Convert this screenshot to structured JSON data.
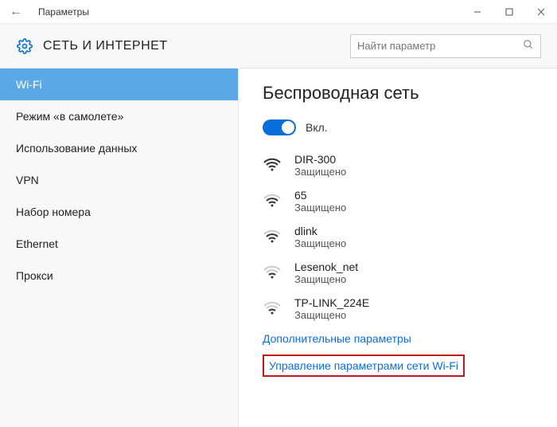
{
  "titlebar": {
    "back_icon": "←",
    "title": "Параметры"
  },
  "header": {
    "title": "СЕТЬ И ИНТЕРНЕТ",
    "search_placeholder": "Найти параметр"
  },
  "sidebar": {
    "items": [
      {
        "label": "Wi-Fi",
        "active": true
      },
      {
        "label": "Режим «в самолете»",
        "active": false
      },
      {
        "label": "Использование данных",
        "active": false
      },
      {
        "label": "VPN",
        "active": false
      },
      {
        "label": "Набор номера",
        "active": false
      },
      {
        "label": "Ethernet",
        "active": false
      },
      {
        "label": "Прокси",
        "active": false
      }
    ]
  },
  "main": {
    "heading": "Беспроводная сеть",
    "toggle_label": "Вкл.",
    "toggle_on": true,
    "networks": [
      {
        "name": "DIR-300",
        "status": "Защищено",
        "strength": 4
      },
      {
        "name": "65",
        "status": "Защищено",
        "strength": 3
      },
      {
        "name": "dlink",
        "status": "Защищено",
        "strength": 3
      },
      {
        "name": "Lesenok_net",
        "status": "Защищено",
        "strength": 2
      },
      {
        "name": "TP-LINK_224E",
        "status": "Защищено",
        "strength": 2
      }
    ],
    "link_more": "Дополнительные параметры",
    "link_manage": "Управление параметрами сети Wi-Fi"
  },
  "colors": {
    "accent": "#0a6fdb",
    "sidebar_active": "#5aa9e6",
    "highlight_box": "#c01818"
  }
}
